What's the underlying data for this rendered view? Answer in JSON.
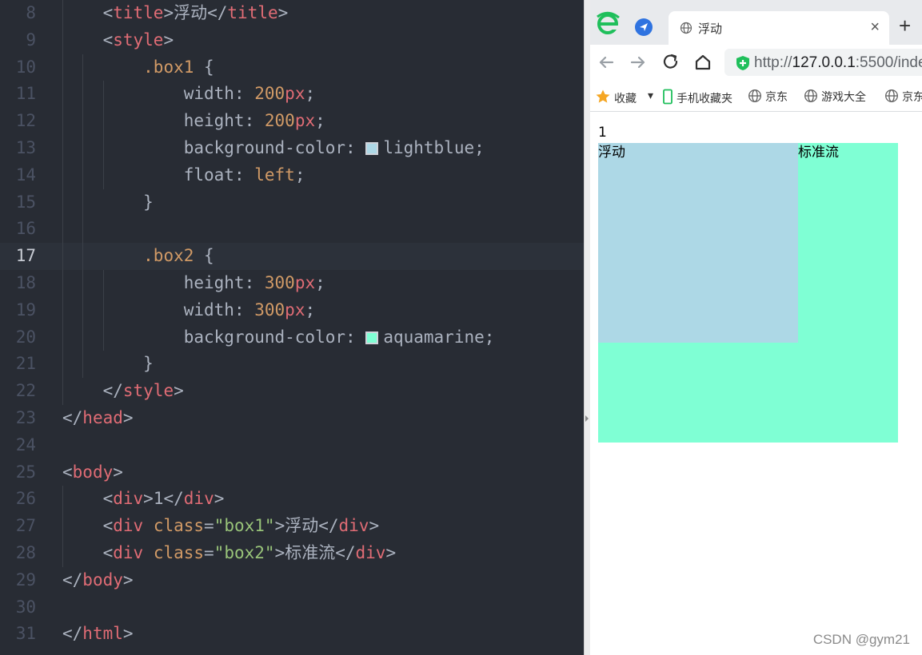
{
  "editor": {
    "current_line": "17",
    "lines": [
      {
        "n": "8",
        "t1": "<",
        "t2": "title",
        "t3": ">",
        "t4": "浮动",
        "t5": "</",
        "t6": "title",
        "t7": ">"
      },
      {
        "n": "9",
        "t1": "<",
        "t2": "style",
        "t3": ">"
      },
      {
        "n": "10",
        "sel": ".box1",
        "brace": " {"
      },
      {
        "n": "11",
        "prop": "width",
        "num": "200",
        "unit": "px"
      },
      {
        "n": "12",
        "prop": "height",
        "num": "200",
        "unit": "px"
      },
      {
        "n": "13",
        "prop": "background-color",
        "color_name": "lightblue",
        "swatch": "#add8e6"
      },
      {
        "n": "14",
        "prop": "float",
        "value": "left"
      },
      {
        "n": "15",
        "close": "}"
      },
      {
        "n": "16"
      },
      {
        "n": "17",
        "sel": ".box2",
        "brace": " {"
      },
      {
        "n": "18",
        "prop": "height",
        "num": "300",
        "unit": "px"
      },
      {
        "n": "19",
        "prop": "width",
        "num": "300",
        "unit": "px"
      },
      {
        "n": "20",
        "prop": "background-color",
        "color_name": "aquamarine",
        "swatch": "#7fffd4"
      },
      {
        "n": "21",
        "close": "}"
      },
      {
        "n": "22",
        "t1": "</",
        "t2": "style",
        "t3": ">"
      },
      {
        "n": "23",
        "t1": "</",
        "t2": "head",
        "t3": ">"
      },
      {
        "n": "24"
      },
      {
        "n": "25",
        "t1": "<",
        "t2": "body",
        "t3": ">"
      },
      {
        "n": "26",
        "t1": "<",
        "t2": "div",
        "t3": ">",
        "t4": "1",
        "t5": "</",
        "t6": "div",
        "t7": ">"
      },
      {
        "n": "27",
        "t1": "<",
        "t2": "div",
        "a": "class",
        "eq": "=",
        "s": "\"box1\"",
        "t3": ">",
        "t4": "浮动",
        "t5": "</",
        "t6": "div",
        "t7": ">"
      },
      {
        "n": "28",
        "t1": "<",
        "t2": "div",
        "a": "class",
        "eq": "=",
        "s": "\"box2\"",
        "t3": ">",
        "t4": "标准流",
        "t5": "</",
        "t6": "div",
        "t7": ">"
      },
      {
        "n": "29",
        "t1": "</",
        "t2": "body",
        "t3": ">"
      },
      {
        "n": "30"
      },
      {
        "n": "31",
        "t1": "</",
        "t2": "html",
        "t3": ">"
      }
    ]
  },
  "browser": {
    "tab_title": "浮动",
    "tab_close": "×",
    "new_tab": "+",
    "url_scheme": "http://",
    "url_host": "127.0.0.1",
    "url_rest": ":5500/inde",
    "bookmarks": [
      {
        "label": "收藏",
        "icon": "star-icon"
      },
      {
        "label": "手机收藏夹",
        "icon": "phone-icon"
      },
      {
        "label": "京东",
        "icon": "globe-icon"
      },
      {
        "label": "游戏大全",
        "icon": "globe-icon"
      },
      {
        "label": "京东",
        "icon": "globe-icon"
      }
    ],
    "colors": {
      "box1": "#add8e6",
      "box2": "#7fffd4"
    }
  },
  "page": {
    "div1_text": "1",
    "box1_text": "浮动",
    "box2_text": "标准流"
  },
  "watermark": "CSDN @gym21"
}
